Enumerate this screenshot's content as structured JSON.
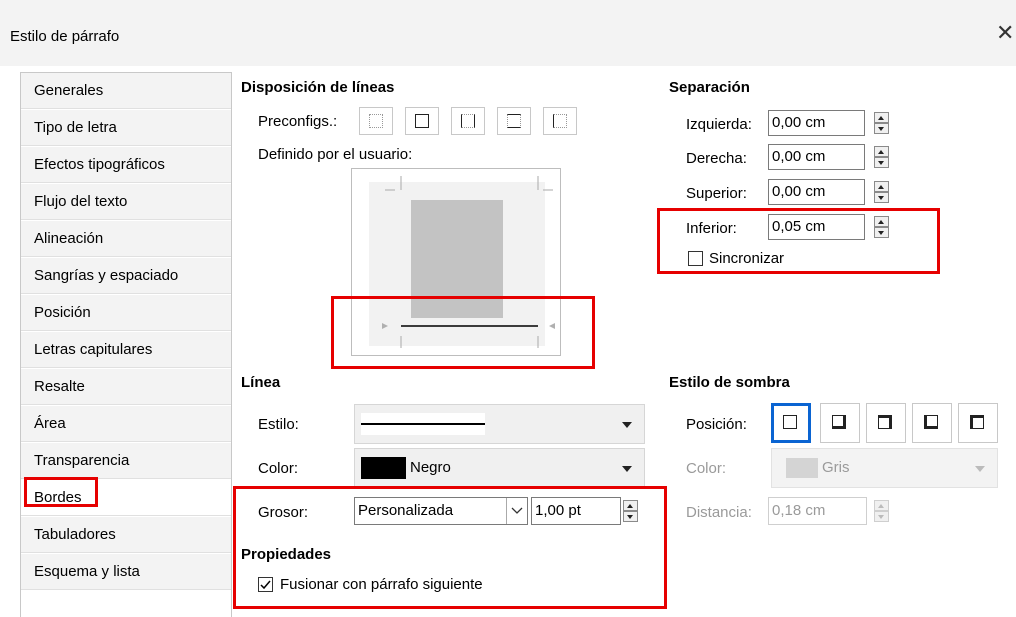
{
  "window": {
    "title": "Estilo de párrafo",
    "close_symbol": "✕"
  },
  "sidebar": {
    "items": [
      {
        "label": "Generales"
      },
      {
        "label": "Tipo de letra"
      },
      {
        "label": "Efectos tipográficos"
      },
      {
        "label": "Flujo del texto"
      },
      {
        "label": "Alineación"
      },
      {
        "label": "Sangrías y espaciado"
      },
      {
        "label": "Posición"
      },
      {
        "label": "Letras capitulares"
      },
      {
        "label": "Resalte"
      },
      {
        "label": "Área"
      },
      {
        "label": "Transparencia"
      },
      {
        "label": "Bordes"
      },
      {
        "label": "Tabuladores"
      },
      {
        "label": "Esquema y lista"
      }
    ],
    "active": "Bordes"
  },
  "line_arrangement": {
    "heading": "Disposición de líneas",
    "presets_label": "Preconfigs.:",
    "user_defined_label": "Definido por el usuario:",
    "presets": [
      "none",
      "all",
      "left-right",
      "top-bottom",
      "left"
    ]
  },
  "padding": {
    "heading": "Separación",
    "left_label": "Izquierda:",
    "left_value": "0,00 cm",
    "right_label": "Derecha:",
    "right_value": "0,00 cm",
    "top_label": "Superior:",
    "top_value": "0,00 cm",
    "bottom_label": "Inferior:",
    "bottom_value": "0,05 cm",
    "sync_label": "Sincronizar",
    "sync_checked": false
  },
  "line": {
    "heading": "Línea",
    "style_label": "Estilo:",
    "color_label": "Color:",
    "color_value": "Negro",
    "color_swatch": "#000000",
    "width_label": "Grosor:",
    "width_preset": "Personalizada",
    "width_value": "1,00 pt"
  },
  "properties": {
    "heading": "Propiedades",
    "merge_label": "Fusionar con párrafo siguiente",
    "merge_checked": true
  },
  "shadow": {
    "heading": "Estilo de sombra",
    "position_label": "Posición:",
    "positions": [
      "none",
      "bottom-right",
      "top-right",
      "bottom-left",
      "top-left"
    ],
    "selected": "none",
    "color_label": "Color:",
    "color_value": "Gris",
    "color_swatch": "#c8c8c8",
    "distance_label": "Distancia:",
    "distance_value": "0,18 cm"
  },
  "colors": {
    "highlight": "#e60000",
    "selection": "#0a64d2"
  }
}
